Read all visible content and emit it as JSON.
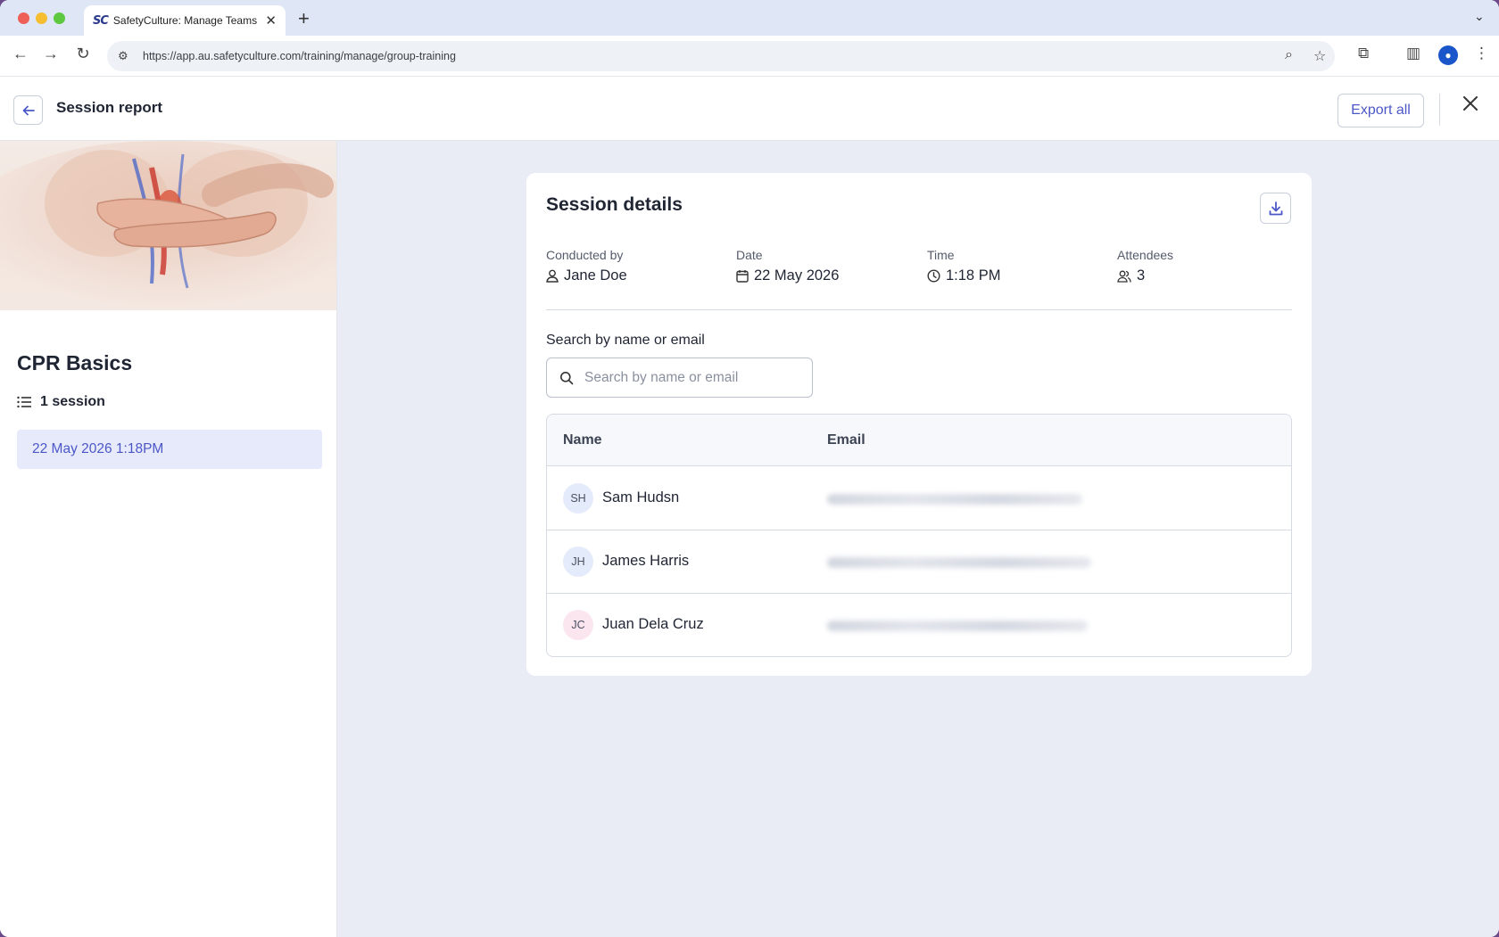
{
  "browser": {
    "tab_title": "SafetyCulture: Manage Teams and...",
    "tab_favicon": "SC",
    "url": "https://app.au.safetyculture.com/training/manage/group-training"
  },
  "header": {
    "title": "Session report",
    "export_label": "Export all"
  },
  "sidebar": {
    "course_title": "CPR Basics",
    "session_count": "1 session",
    "sessions": [
      {
        "label": "22 May 2026 1:18PM"
      }
    ]
  },
  "session_details": {
    "title": "Session details",
    "conducted_by_label": "Conducted by",
    "conducted_by": "Jane Doe",
    "date_label": "Date",
    "date": "22 May 2026",
    "time_label": "Time",
    "time": "1:18 PM",
    "attendees_label": "Attendees",
    "attendees": "3"
  },
  "search": {
    "label": "Search by name or email",
    "placeholder": "Search by name or email",
    "value": ""
  },
  "table": {
    "columns": [
      "Name",
      "Email"
    ],
    "rows": [
      {
        "initials": "SH",
        "name": "Sam Hudsn",
        "avatar_color": "#e4ebfa"
      },
      {
        "initials": "JH",
        "name": "James Harris",
        "avatar_color": "#e4ebfa"
      },
      {
        "initials": "JC",
        "name": "Juan Dela Cruz",
        "avatar_color": "#fbe6ef"
      }
    ]
  },
  "colors": {
    "accent": "#4c57c7",
    "main_bg": "#e9ecf5",
    "selected_bg": "#e7eafb"
  }
}
